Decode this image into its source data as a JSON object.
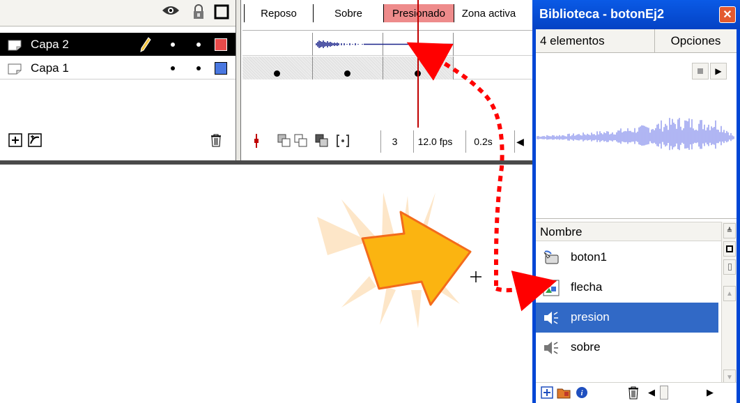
{
  "timeline": {
    "header_icons": [
      "eye-icon",
      "lock-icon",
      "outline-icon"
    ],
    "layers": [
      {
        "name": "Capa 2",
        "selected": true,
        "color": "#e84a4a"
      },
      {
        "name": "Capa 1",
        "selected": false,
        "color": "#4a78e0"
      }
    ],
    "states": [
      "Reposo",
      "Sobre",
      "Presionado",
      "Zona activa"
    ],
    "active_state": "Presionado",
    "current_frame": "3",
    "fps": "12.0 fps",
    "elapsed": "0.2s"
  },
  "library": {
    "title": "Biblioteca - botonEj2",
    "count": "4 elementos",
    "options_label": "Opciones",
    "column_header": "Nombre",
    "items": [
      {
        "name": "boton1",
        "icon": "button-symbol-icon",
        "selected": false
      },
      {
        "name": "flecha",
        "icon": "graphic-symbol-icon",
        "selected": false
      },
      {
        "name": "presion",
        "icon": "sound-icon",
        "selected": true
      },
      {
        "name": "sobre",
        "icon": "sound-icon",
        "selected": false
      }
    ]
  },
  "colors": {
    "active_state": "#ee8b8b",
    "playhead": "#c00000",
    "library_titlebar": "#0046d5",
    "selection": "#3169c6",
    "waveform": "#8e96ee",
    "arrow_fill": "#fbb411",
    "annotation": "#ff0000"
  }
}
